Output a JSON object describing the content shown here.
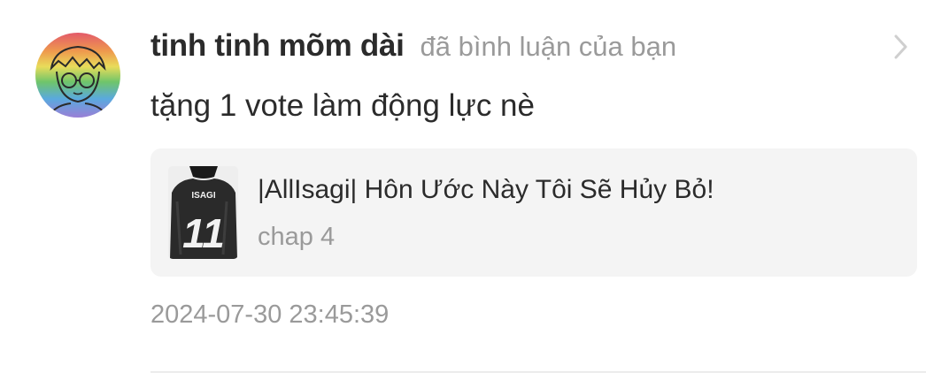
{
  "notification": {
    "user": {
      "name": "tinh tinh mõm dài",
      "avatar_icon": "rainbow-avatar-icon"
    },
    "action_text": "đã bình luận của bạn",
    "comment": "tặng 1 vote làm động lực nè",
    "story": {
      "title": "|AllIsagi| Hôn Ước Này Tôi Sẽ Hủy Bỏ!",
      "chapter": "chap 4",
      "cover_icon": "jersey-11-cover-icon"
    },
    "timestamp": "2024-07-30 23:45:39",
    "chevron_icon": "chevron-right-icon"
  }
}
